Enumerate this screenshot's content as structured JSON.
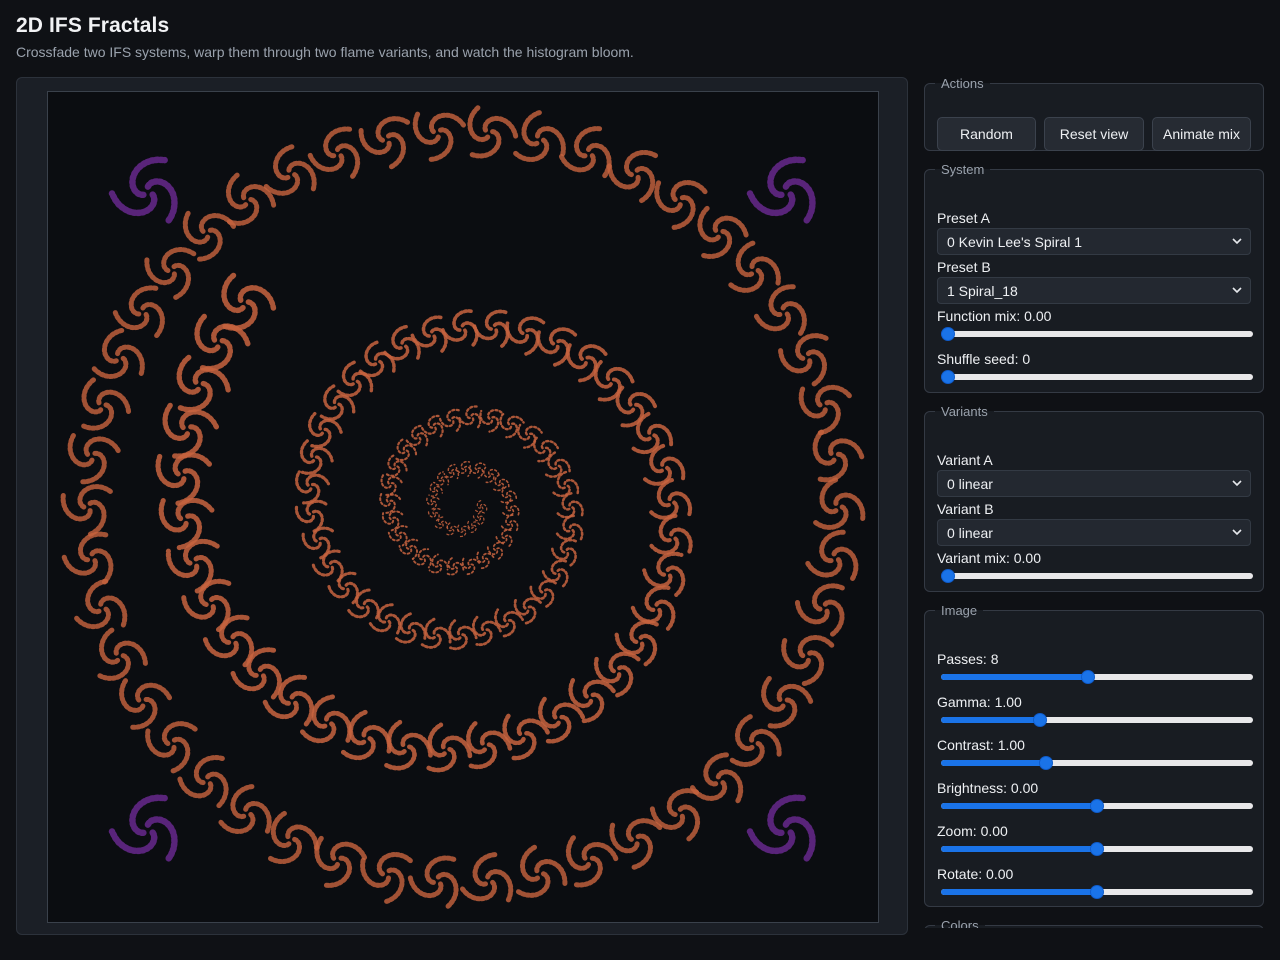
{
  "header": {
    "title": "2D IFS Fractals",
    "subtitle": "Crossfade two IFS systems, warp them through two flame variants, and watch the histogram bloom."
  },
  "actions": {
    "legend": "Actions",
    "random_label": "Random",
    "reset_label": "Reset view",
    "animate_label": "Animate mix"
  },
  "system": {
    "legend": "System",
    "preset_a_label": "Preset A",
    "preset_a_value": "0 Kevin Lee's Spiral 1",
    "preset_b_label": "Preset B",
    "preset_b_value": "1 Spiral_18",
    "function_mix_label": "Function mix: 0.00",
    "function_mix": 0.0,
    "shuffle_seed_label": "Shuffle seed: 0",
    "shuffle_seed": 0.0
  },
  "variants": {
    "legend": "Variants",
    "variant_a_label": "Variant A",
    "variant_a_value": "0 linear",
    "variant_b_label": "Variant B",
    "variant_b_value": "0 linear",
    "variant_mix_label": "Variant mix: 0.00",
    "variant_mix": 0.0
  },
  "image": {
    "legend": "Image",
    "passes_label": "Passes: 8",
    "passes": 0.47,
    "gamma_label": "Gamma: 1.00",
    "gamma": 0.31,
    "contrast_label": "Contrast: 1.00",
    "contrast": 0.33,
    "brightness_label": "Brightness: 0.00",
    "brightness": 0.5,
    "zoom_label": "Zoom: 0.00",
    "zoom": 0.5,
    "rotate_label": "Rotate: 0.00",
    "rotate": 0.5
  },
  "colors": {
    "legend": "Colors"
  },
  "palette": {
    "accent": "#1a73e8",
    "fractal_primary": "#c8643f",
    "fractal_secondary": "#7a2fa6"
  }
}
